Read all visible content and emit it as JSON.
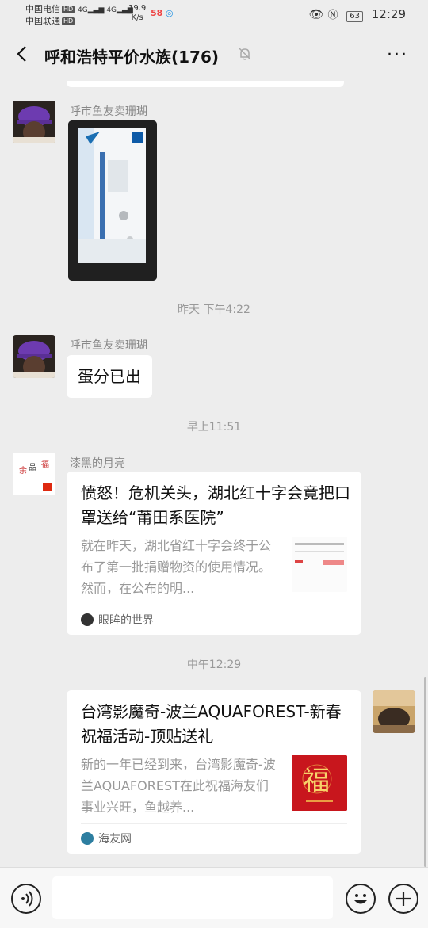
{
  "status_bar": {
    "carrier_1": "中国电信",
    "carrier_2": "中国联通",
    "hd_badge": "HD",
    "network": "4G",
    "speed_value": "19.9",
    "speed_unit": "K/s",
    "app_badge": "58",
    "battery": "63",
    "time": "12:29"
  },
  "header": {
    "title": "呼和浩特平价水族(176)"
  },
  "messages": {
    "msg1_sender": "呼市鱼友卖珊瑚",
    "time_1": "昨天 下午4:22",
    "msg2_sender": "呼市鱼友卖珊瑚",
    "msg2_text": "蛋分已出",
    "time_2": "早上11:51",
    "msg3_sender": "漆黑的月亮",
    "card1": {
      "title": "愤怒！危机关头，湖北红十字会竟把口罩送给“莆田系医院”",
      "desc": "就在昨天，湖北省红十字会终于公布了第一批捐赠物资的使用情况。然而，在公布的明...",
      "source": "眼眸的世界"
    },
    "time_3": "中午12:29",
    "card2": {
      "title": "台湾影魔奇-波兰AQUAFOREST-新春祝福活动-顶贴送礼",
      "desc": "新的一年已经到来，台湾影魔奇-波兰AQUAFOREST在此祝福海友们事业兴旺，鱼越养...",
      "source": "海友网"
    }
  },
  "colors": {
    "background": "#ededed",
    "bubble": "#ffffff",
    "muted_text": "#999999"
  }
}
